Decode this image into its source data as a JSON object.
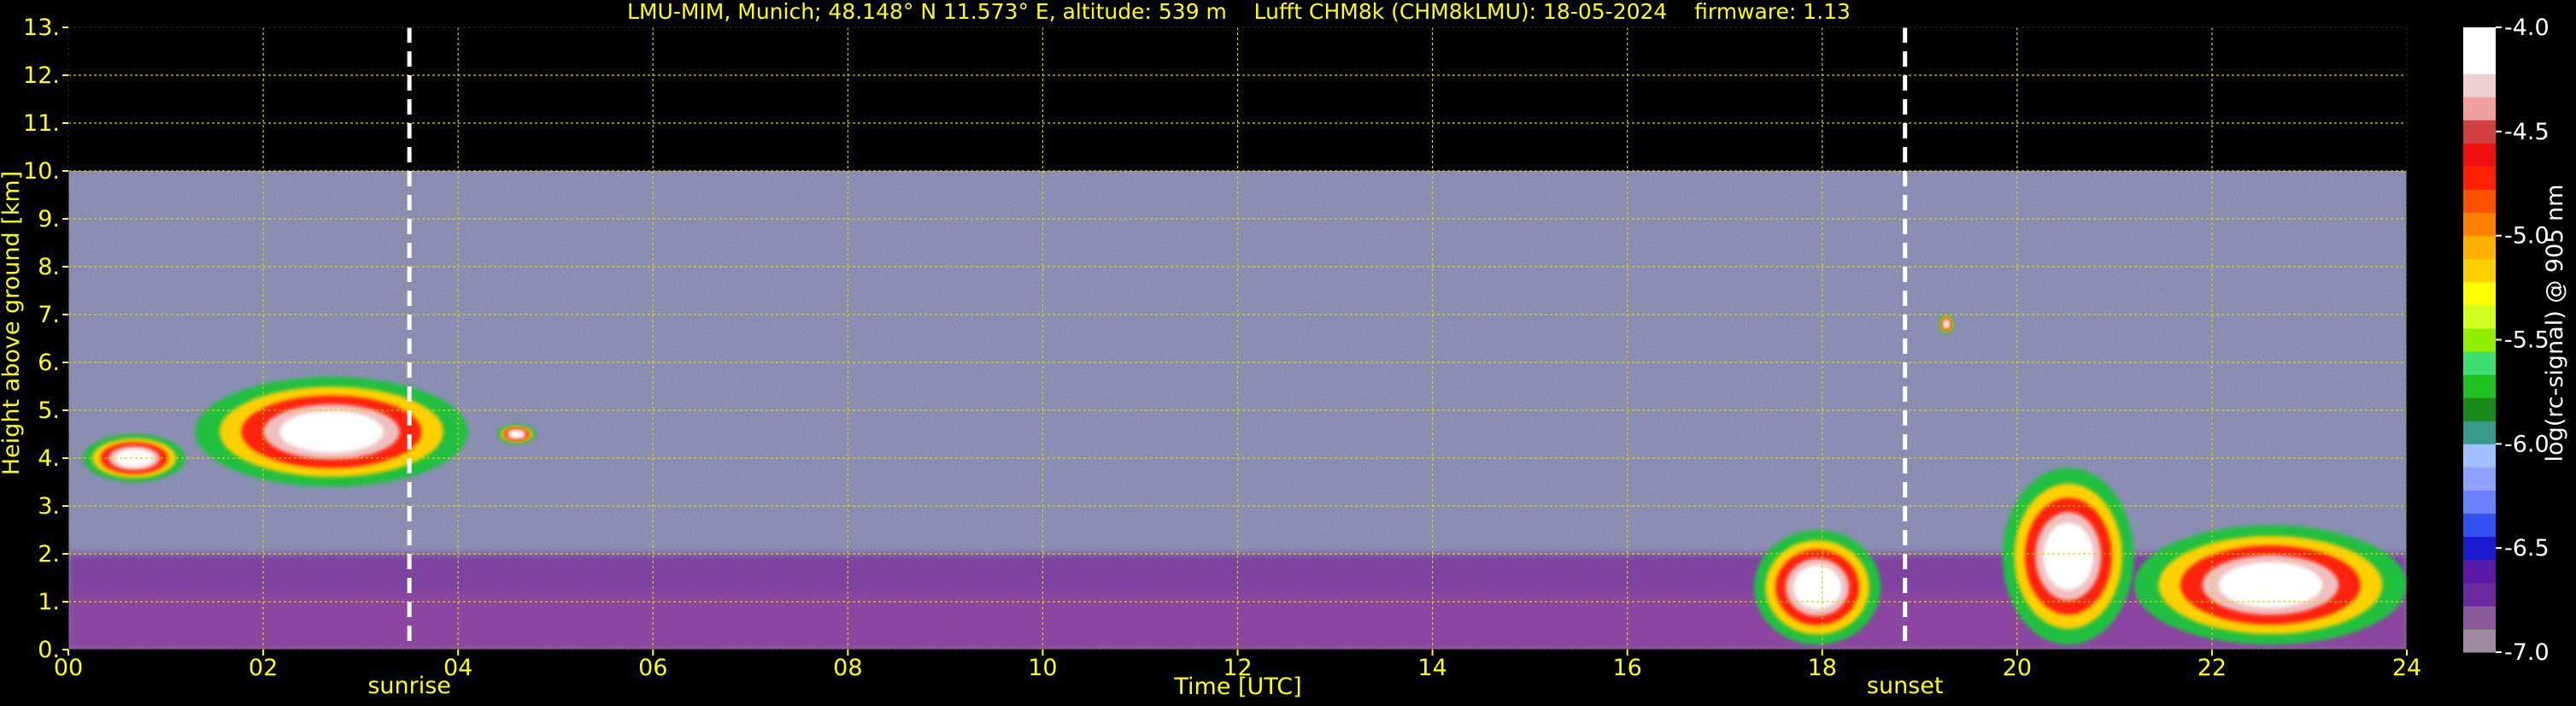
{
  "chart_data": {
    "type": "heatmap",
    "title": "LMU-MIM, Munich; 48.148° N 11.573° E, altitude: 539 m    Lufft CHM8k (CHM8kLMU): 18-05-2024    firmware: 1.13",
    "xlabel": "Time [UTC]",
    "ylabel": "Height above ground [km]",
    "xlim": [
      0,
      24
    ],
    "ylim": [
      0,
      13
    ],
    "x_ticks": [
      "00",
      "02",
      "04",
      "06",
      "08",
      "10",
      "12",
      "14",
      "16",
      "18",
      "20",
      "22",
      "24"
    ],
    "y_ticks": [
      "0.",
      "1.",
      "2.",
      "3.",
      "4.",
      "5.",
      "6.",
      "7.",
      "8.",
      "9.",
      "10.",
      "11.",
      "12.",
      "13."
    ],
    "grid": true,
    "measurement_top_km": 10,
    "markers": [
      {
        "label": "sunrise",
        "time": 3.5
      },
      {
        "label": "sunset",
        "time": 18.85
      }
    ],
    "colorbar": {
      "label": "log(rc-signal) @ 905 nm",
      "range": [
        -7.0,
        -4.0
      ],
      "tick_labels": [
        "-4.0",
        "-4.5",
        "-5.0",
        "-5.5",
        "-6.0",
        "-6.5",
        "-7.0"
      ],
      "colors": [
        "#a08aa0",
        "#8a5a9a",
        "#6a2aa0",
        "#5a1aa5",
        "#1a1ad0",
        "#3050f0",
        "#6a80ff",
        "#90a0ff",
        "#a0c0ff",
        "#3a9a8a",
        "#1a8a1a",
        "#20c020",
        "#40e070",
        "#90f000",
        "#d0ff20",
        "#ffff00",
        "#ffd000",
        "#ffb000",
        "#ff8000",
        "#ff5000",
        "#ff2000",
        "#f01010",
        "#d04040",
        "#f0a0a0",
        "#f0d0d0",
        "#ffffff",
        "#ffffff"
      ]
    },
    "features": [
      {
        "label": "aerosol boundary layer",
        "start": 0,
        "end": 24,
        "base_km": 0,
        "top_km_start": 2.0,
        "top_km_end": 2.0
      },
      {
        "label": "cloud",
        "start": 0.15,
        "end": 1.2,
        "base_km": 3.5,
        "top_km": 4.5
      },
      {
        "label": "cloud",
        "start": 1.3,
        "end": 4.1,
        "base_km": 3.4,
        "top_km": 5.7
      },
      {
        "label": "cloud",
        "start": 4.4,
        "end": 4.8,
        "base_km": 4.3,
        "top_km": 4.7
      },
      {
        "label": "cloud",
        "start": 17.3,
        "end": 18.6,
        "base_km": 0.1,
        "top_km": 2.5
      },
      {
        "label": "cloud",
        "start": 19.85,
        "end": 21.2,
        "base_km": 0.1,
        "top_km": 3.8
      },
      {
        "label": "cloud",
        "start": 21.2,
        "end": 24.0,
        "base_km": 0.1,
        "top_km": 2.6
      },
      {
        "label": "cloud",
        "start": 19.2,
        "end": 19.35,
        "base_km": 6.6,
        "top_km": 7.0
      }
    ]
  }
}
